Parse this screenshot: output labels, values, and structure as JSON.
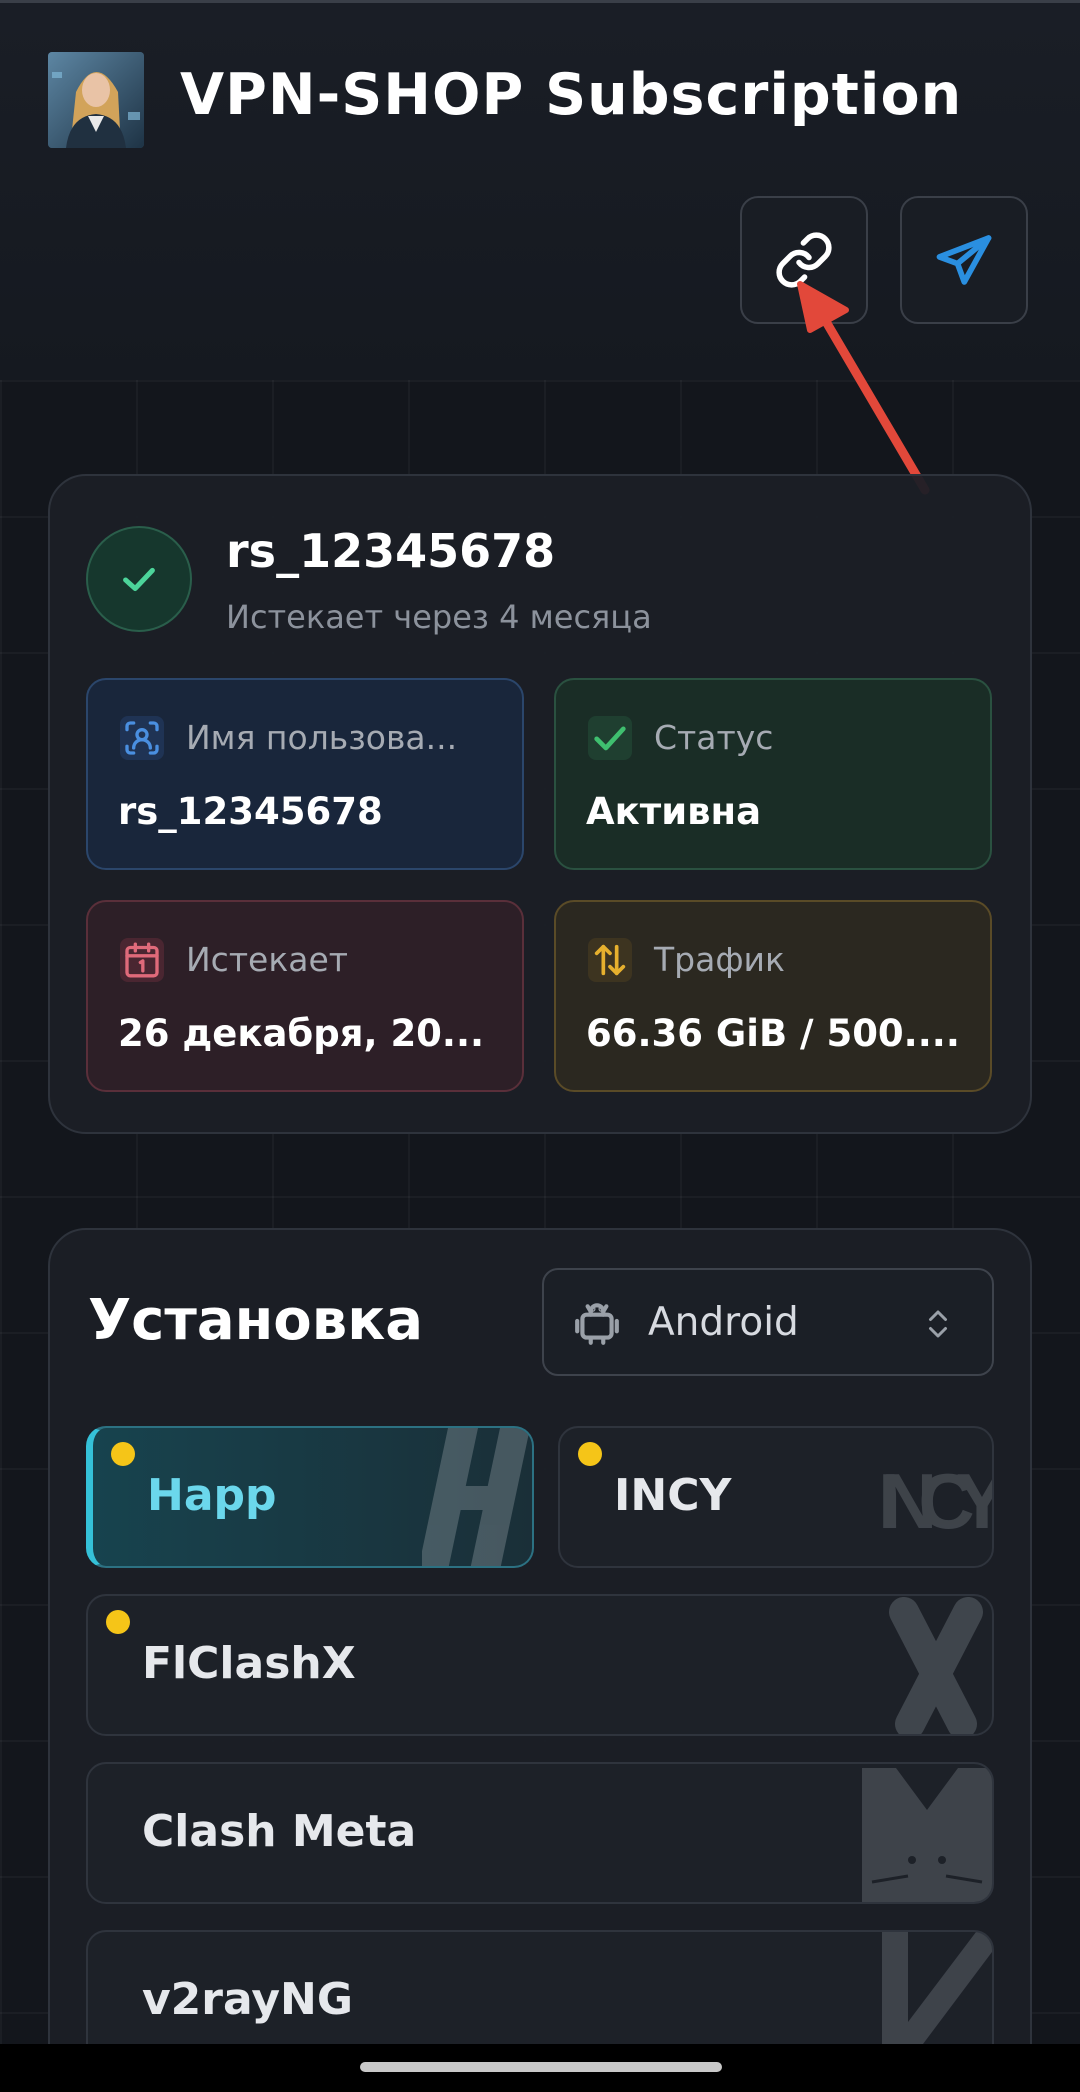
{
  "header": {
    "title": "VPN-SHOP Subscription"
  },
  "user": {
    "name": "rs_12345678",
    "expiry_text": "Истекает через 4 месяца"
  },
  "info_tiles": [
    {
      "label": "Имя пользова...",
      "value": "rs_12345678",
      "icon": "user-scan-icon",
      "color": "#4a8fe0"
    },
    {
      "label": "Статус",
      "value": "Активна",
      "icon": "check-icon",
      "color": "#3fbf6f"
    },
    {
      "label": "Истекает",
      "value": "26 декабря, 20...",
      "icon": "calendar-icon",
      "color": "#e06a7a"
    },
    {
      "label": "Трафик",
      "value": "66.36 GiB / 500....",
      "icon": "arrows-up-down-icon",
      "color": "#e6b02e"
    }
  ],
  "install": {
    "title": "Установка",
    "platform": "Android",
    "apps": [
      {
        "name": "Happ",
        "active": true,
        "featured": true
      },
      {
        "name": "INCY",
        "active": false,
        "featured": true
      },
      {
        "name": "FlClashX",
        "active": false,
        "featured": true
      },
      {
        "name": "Clash Meta",
        "active": false,
        "featured": false
      },
      {
        "name": "v2rayNG",
        "active": false,
        "featured": false
      }
    ]
  },
  "colors": {
    "accent": "#35c1d8",
    "telegram": "#2a8fe0",
    "featured_dot": "#f5c518",
    "annotation_arrow": "#e2483a"
  }
}
